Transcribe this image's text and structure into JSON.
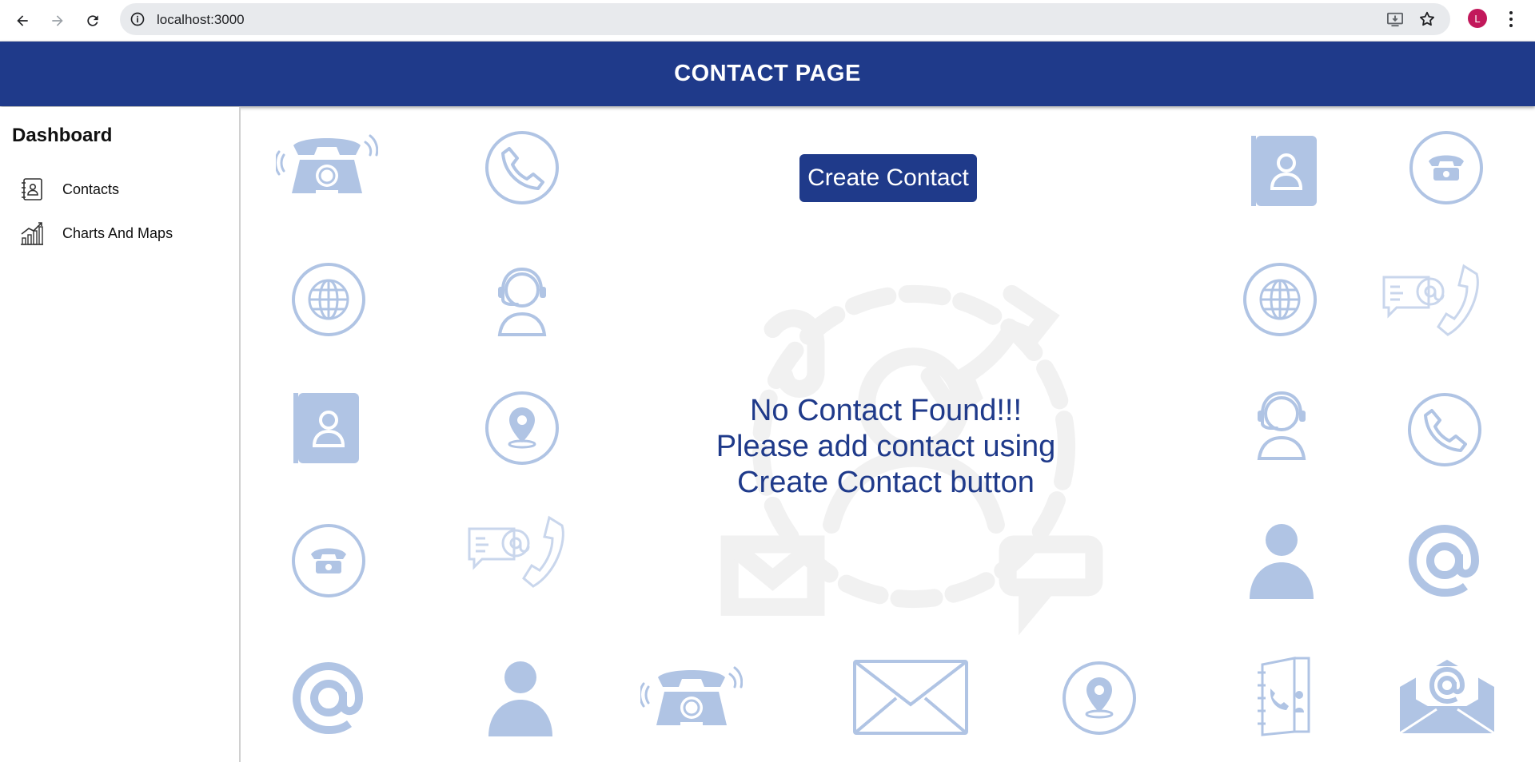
{
  "browser": {
    "url": "localhost:3000",
    "avatar_letter": "L"
  },
  "header": {
    "title": "CONTACT PAGE"
  },
  "sidebar": {
    "title": "Dashboard",
    "items": [
      {
        "label": "Contacts",
        "icon": "address-book-icon"
      },
      {
        "label": "Charts And Maps",
        "icon": "bar-chart-icon"
      }
    ]
  },
  "main": {
    "create_button_label": "Create Contact",
    "empty_message": {
      "line1": "No Contact Found!!!",
      "line2": "Please add contact using",
      "line3": "Create Contact button"
    }
  },
  "colors": {
    "primary": "#1f3a8a",
    "icon_light": "#b0c4e4",
    "avatar": "#c2185b"
  }
}
